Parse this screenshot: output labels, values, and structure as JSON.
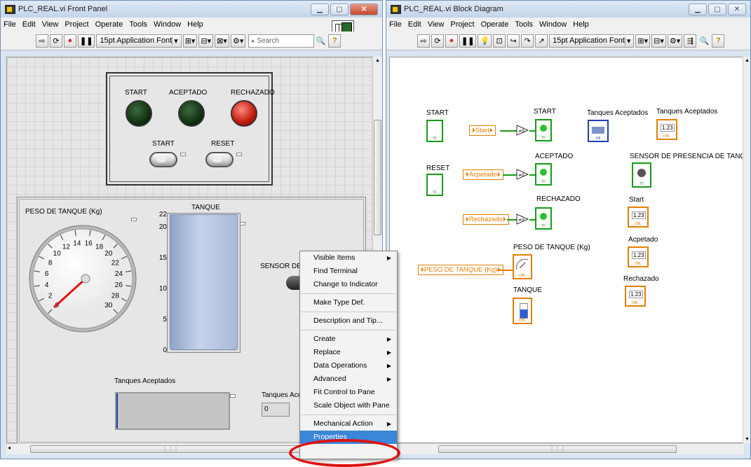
{
  "front_panel": {
    "title": "PLC_REAL.vi Front Panel",
    "menu": [
      "File",
      "Edit",
      "View",
      "Project",
      "Operate",
      "Tools",
      "Window",
      "Help"
    ],
    "font": "15pt Application Font",
    "search_placeholder": "Search",
    "cluster": {
      "leds": [
        {
          "label": "START",
          "state": "off",
          "color": "#1f4d1f"
        },
        {
          "label": "ACEPTADO",
          "state": "off",
          "color": "#1f4d1f"
        },
        {
          "label": "RECHAZADO",
          "state": "on",
          "color": "#d4190c"
        }
      ],
      "buttons": [
        {
          "label": "START"
        },
        {
          "label": "RESET"
        }
      ]
    },
    "gauge": {
      "label": "PESO DE TANQUE (Kg)",
      "ticks": [
        "0",
        "2",
        "4",
        "6",
        "8",
        "10",
        "12",
        "14",
        "16",
        "18",
        "20",
        "22",
        "24",
        "26",
        "28",
        "30"
      ],
      "value": 0
    },
    "tank": {
      "label": "TANQUE",
      "ticks": [
        "22",
        "20",
        "15",
        "10",
        "5",
        "0"
      ],
      "value": 22
    },
    "sensor_label": "SENSOR DE PR",
    "accepted_array_label": "Tanques Aceptados",
    "accepted_count_label": "Tanques Acep",
    "accepted_count_value": "0",
    "context_menu": {
      "items": [
        {
          "label": "Visible Items",
          "submenu": true
        },
        {
          "label": "Find Terminal",
          "submenu": false
        },
        {
          "label": "Change to Indicator",
          "submenu": false
        },
        {
          "sep": true
        },
        {
          "label": "Make Type Def.",
          "submenu": false
        },
        {
          "sep": true
        },
        {
          "label": "Description and Tip...",
          "submenu": false
        },
        {
          "sep": true
        },
        {
          "label": "Create",
          "submenu": true
        },
        {
          "label": "Replace",
          "submenu": true
        },
        {
          "label": "Data Operations",
          "submenu": true
        },
        {
          "label": "Advanced",
          "submenu": true
        },
        {
          "label": "Fit Control to Pane",
          "submenu": false
        },
        {
          "label": "Scale Object with Pane",
          "submenu": false
        },
        {
          "sep": true
        },
        {
          "label": "Mechanical Action",
          "submenu": true
        },
        {
          "label": "Properties",
          "submenu": false,
          "highlighted": true
        }
      ]
    }
  },
  "block_diagram": {
    "title": "PLC_REAL.vi Block Diagram",
    "menu": [
      "File",
      "Edit",
      "View",
      "Project",
      "Operate",
      "Tools",
      "Window",
      "Help"
    ],
    "font": "15pt Application Font",
    "labels": {
      "start_ctrl": "START",
      "reset_ctrl": "RESET",
      "start_led": "START",
      "aceptado_led": "ACEPTADO",
      "rechazado_led": "RECHAZADO",
      "tanques_array": "Tanques Aceptados",
      "tanques_num": "Tanques Aceptados",
      "sensor": "SENSOR DE PRESENCIA DE TANQUE",
      "start_num": "Start",
      "acpetado_num": "Acpetado",
      "rechazado_num": "Rechazado",
      "peso_gauge": "PESO DE TANQUE (Kg)",
      "tanque": "TANQUE"
    },
    "locals": {
      "start": "Start",
      "acpetado": "Acpetado",
      "rechazado": "Rechazado",
      "peso": "PESO DE TANQUE (Kg)"
    }
  },
  "colors": {
    "bool_wire": "#159c15",
    "num_wire": "#e67e00",
    "selection": "#3a86d8",
    "annotation": "#e01010"
  }
}
